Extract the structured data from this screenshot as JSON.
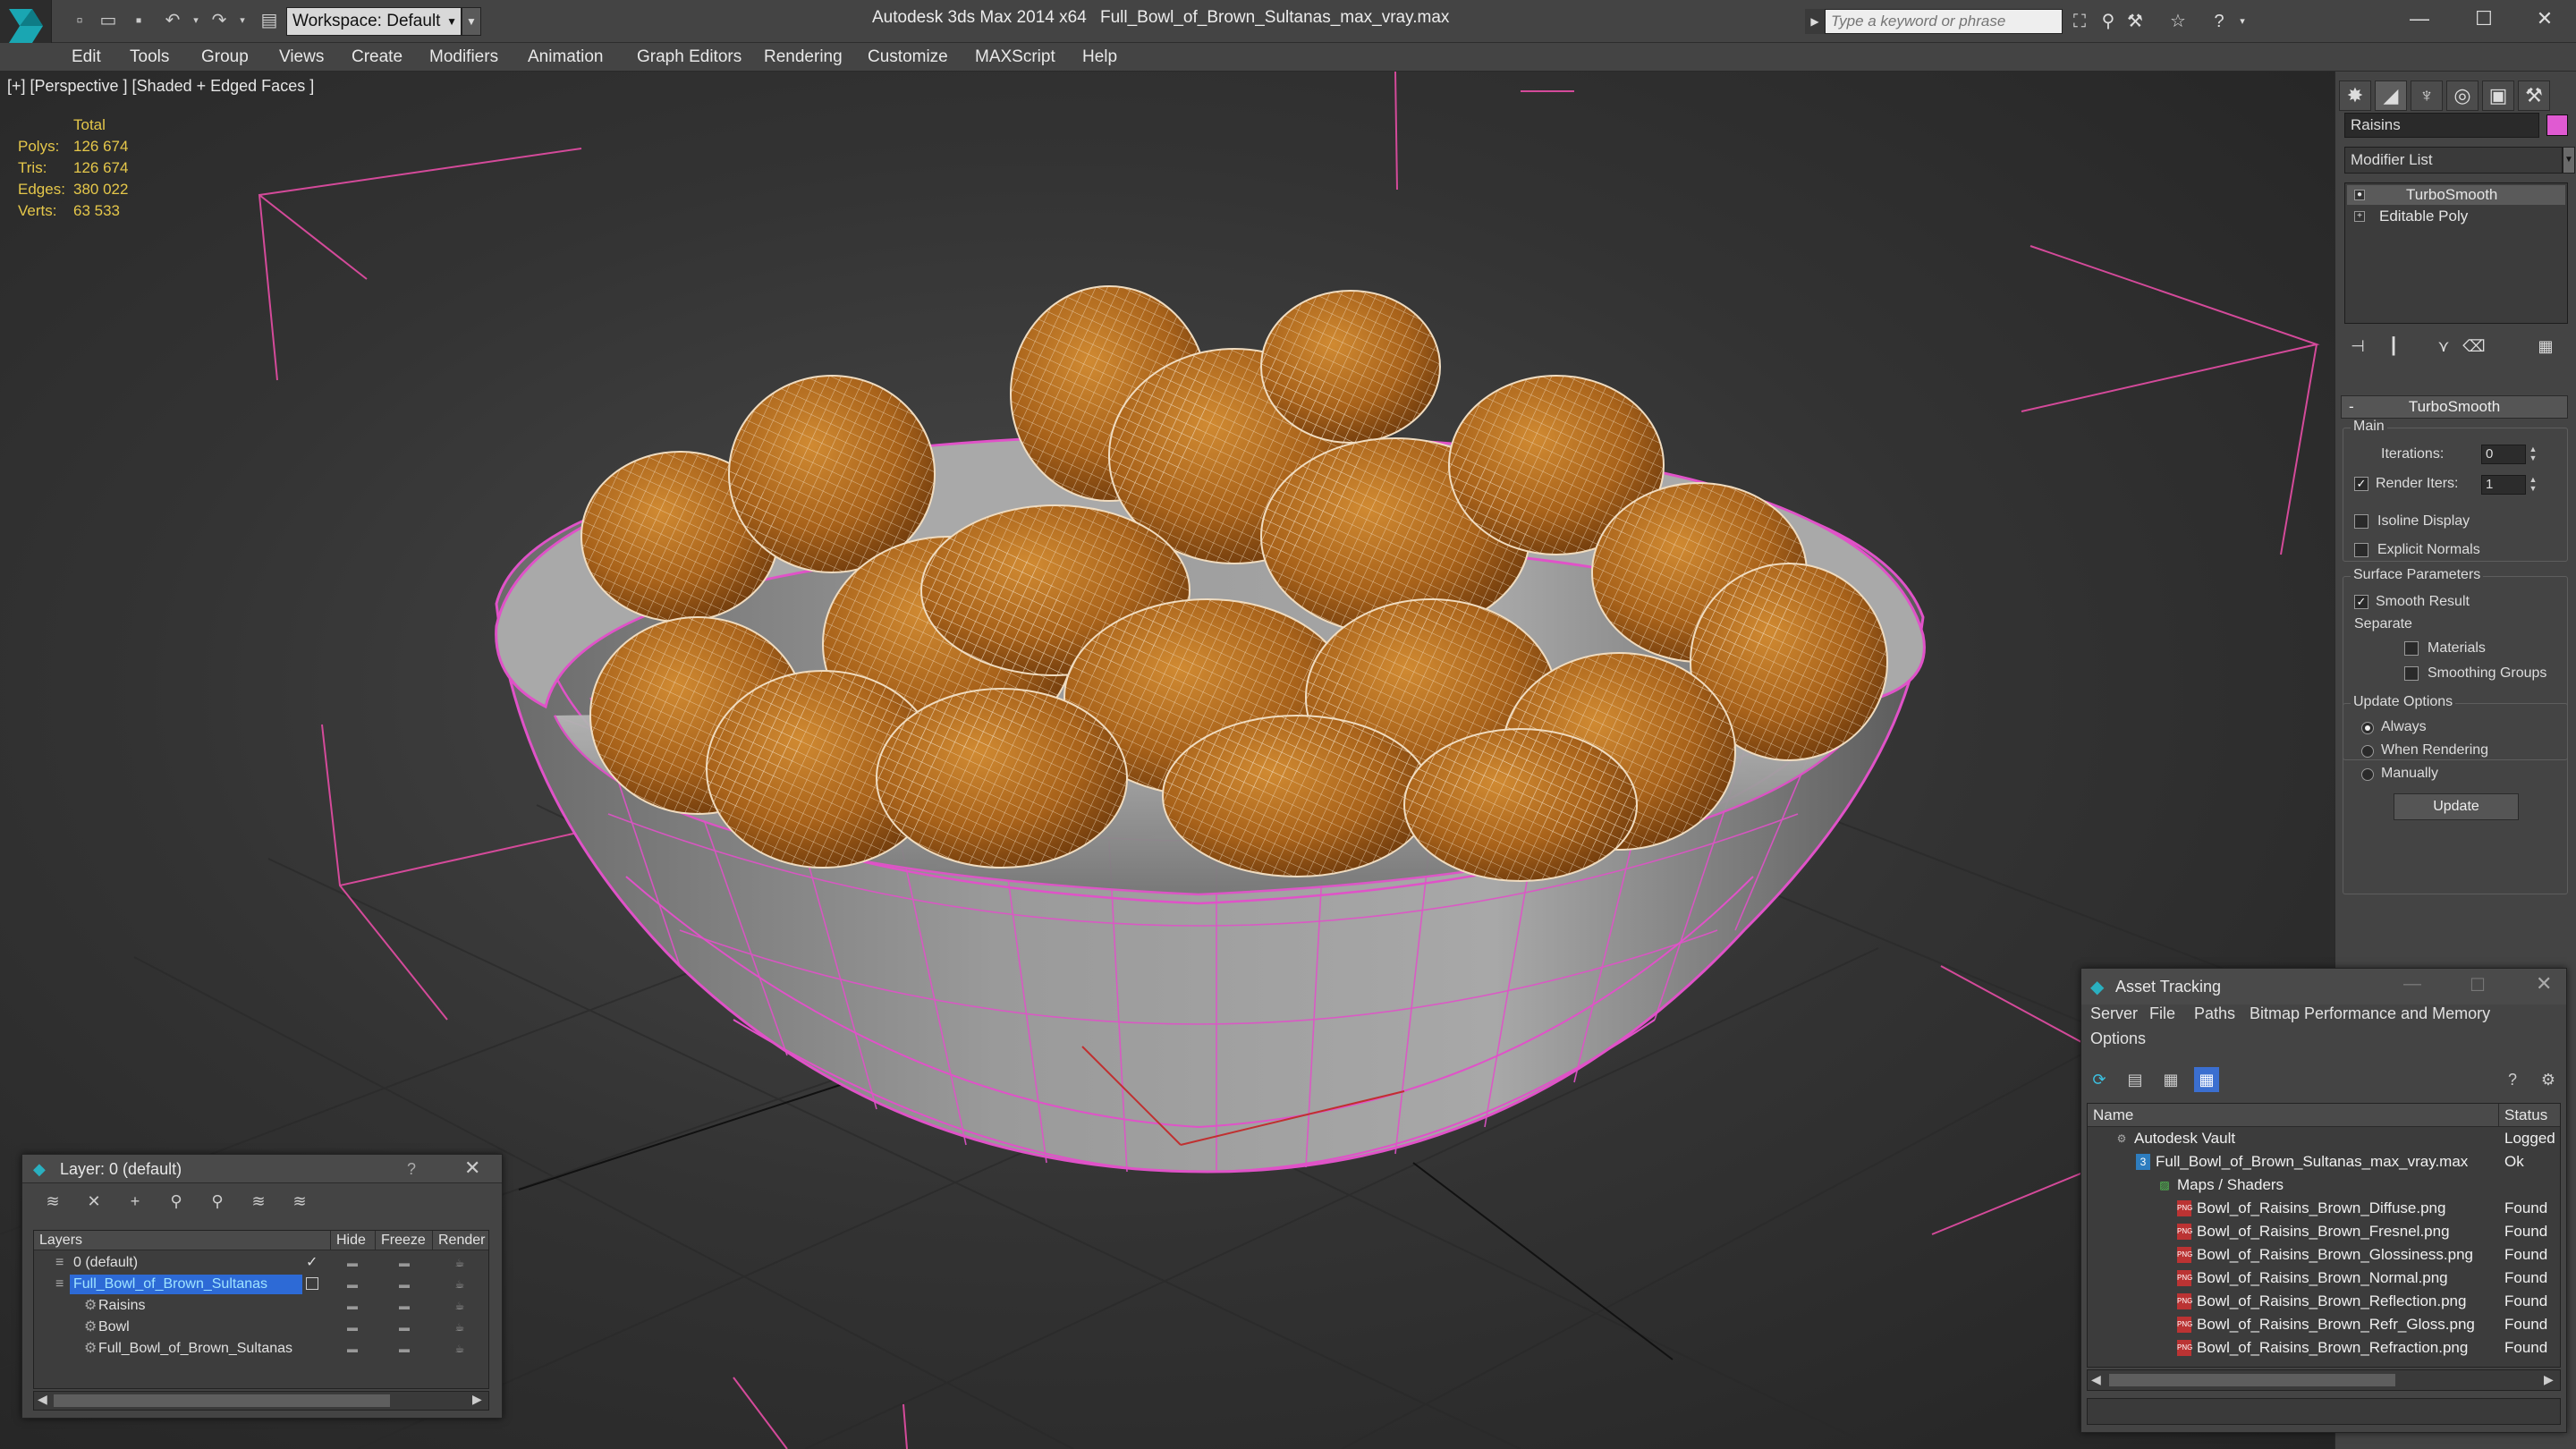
{
  "titlebar": {
    "workspace": "Workspace: Default",
    "app_title": "Autodesk 3ds Max  2014 x64",
    "file_title": "Full_Bowl_of_Brown_Sultanas_max_vray.max",
    "search_placeholder": "Type a keyword or phrase"
  },
  "menu": [
    "Edit",
    "Tools",
    "Group",
    "Views",
    "Create",
    "Modifiers",
    "Animation",
    "Graph Editors",
    "Rendering",
    "Customize",
    "MAXScript",
    "Help"
  ],
  "viewport": {
    "label": "[+] [Perspective ] [Shaded + Edged Faces ]",
    "stats_header": "Total",
    "stats": [
      {
        "k": "Polys:",
        "v": "126 674"
      },
      {
        "k": "Tris:",
        "v": "126 674"
      },
      {
        "k": "Edges:",
        "v": "380 022"
      },
      {
        "k": "Verts:",
        "v": "63 533"
      }
    ],
    "colors": {
      "grid": "#1f1f1f",
      "bowl_wire": "#e052c8",
      "raisin": "#b8701e",
      "camera": "#d44a9a"
    }
  },
  "command_panel": {
    "object_name": "Raisins",
    "object_color": "#e05ad2",
    "modifier_list": "Modifier List",
    "stack": [
      "TurboSmooth",
      "Editable Poly"
    ],
    "rollout_title": "TurboSmooth",
    "main_label": "Main",
    "iterations_label": "Iterations:",
    "iterations_value": "0",
    "render_iters_label": "Render Iters:",
    "render_iters_value": "1",
    "isoline_label": "Isoline Display",
    "explicit_normals_label": "Explicit Normals",
    "surface_params_label": "Surface Parameters",
    "smooth_result_label": "Smooth Result",
    "separate_label": "Separate",
    "materials_label": "Materials",
    "smoothing_groups_label": "Smoothing Groups",
    "update_options_label": "Update Options",
    "always_label": "Always",
    "when_rendering_label": "When Rendering",
    "manually_label": "Manually",
    "update_button": "Update"
  },
  "layer_dialog": {
    "title": "Layer: 0 (default)",
    "help": "?",
    "columns": [
      "Layers",
      "Hide",
      "Freeze",
      "Render"
    ],
    "rows": [
      {
        "name": "0 (default)",
        "indent": 0
      },
      {
        "name": "Full_Bowl_of_Brown_Sultanas",
        "indent": 0
      },
      {
        "name": "Raisins",
        "indent": 1
      },
      {
        "name": "Bowl",
        "indent": 1
      },
      {
        "name": "Full_Bowl_of_Brown_Sultanas",
        "indent": 1
      }
    ]
  },
  "asset_dialog": {
    "title": "Asset Tracking",
    "menu": [
      "Server",
      "File",
      "Paths",
      "Bitmap Performance and Memory",
      "Options"
    ],
    "columns": [
      "Name",
      "Status"
    ],
    "rows": [
      {
        "name": "Autodesk Vault",
        "status": "Logged"
      },
      {
        "name": "Full_Bowl_of_Brown_Sultanas_max_vray.max",
        "status": "Ok"
      },
      {
        "name": "Maps / Shaders",
        "status": ""
      },
      {
        "name": "Bowl_of_Raisins_Brown_Diffuse.png",
        "status": "Found"
      },
      {
        "name": "Bowl_of_Raisins_Brown_Fresnel.png",
        "status": "Found"
      },
      {
        "name": "Bowl_of_Raisins_Brown_Glossiness.png",
        "status": "Found"
      },
      {
        "name": "Bowl_of_Raisins_Brown_Normal.png",
        "status": "Found"
      },
      {
        "name": "Bowl_of_Raisins_Brown_Reflection.png",
        "status": "Found"
      },
      {
        "name": "Bowl_of_Raisins_Brown_Refr_Gloss.png",
        "status": "Found"
      },
      {
        "name": "Bowl_of_Raisins_Brown_Refraction.png",
        "status": "Found"
      }
    ]
  }
}
